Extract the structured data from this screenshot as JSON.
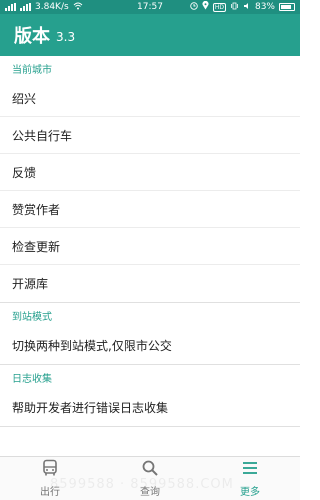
{
  "status_bar": {
    "network_speed": "3.84K/s",
    "time": "17:57",
    "battery": "83%"
  },
  "app_bar": {
    "title": "版本",
    "version": "3.3"
  },
  "sections": {
    "current_city": {
      "header": "当前城市",
      "items": [
        "绍兴",
        "公共自行车",
        "反馈",
        "赞赏作者",
        "检查更新",
        "开源库"
      ]
    },
    "arrival_mode": {
      "header": "到站模式",
      "items": [
        "切换两种到站模式,仅限市公交"
      ]
    },
    "log_collection": {
      "header": "日志收集",
      "items": [
        "帮助开发者进行错误日志收集"
      ]
    }
  },
  "tabs": [
    {
      "label": "出行",
      "icon": "bus-icon"
    },
    {
      "label": "查询",
      "icon": "search-icon"
    },
    {
      "label": "更多",
      "icon": "menu-icon",
      "active": true
    }
  ],
  "watermark": "8599588 · 8599588.COM",
  "colors": {
    "primary": "#26a08e",
    "status_bar": "#1f8f80",
    "accent_text": "#26a08e"
  }
}
